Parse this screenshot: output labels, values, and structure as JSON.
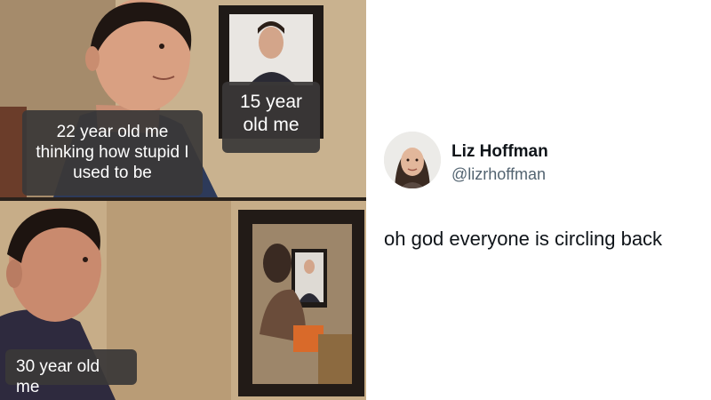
{
  "meme": {
    "captions": {
      "top_left": "22 year old me thinking how stupid I used to be",
      "top_right": "15 year old me",
      "bottom_left": "30 year old me"
    }
  },
  "tweet": {
    "display_name": "Liz Hoffman",
    "handle": "@lizrhoffman",
    "text": "oh god everyone is circling back"
  }
}
